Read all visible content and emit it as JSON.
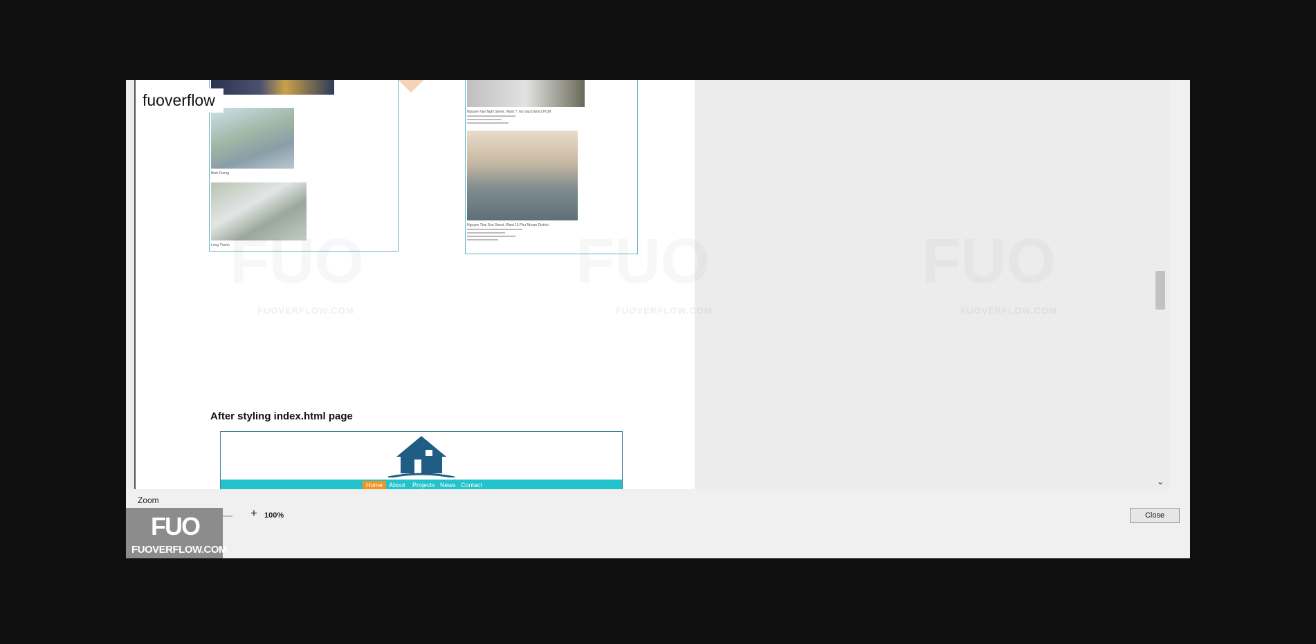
{
  "brand_label": "fuoverflow",
  "section_heading": "After styling index.html page",
  "nav_items": [
    "Home",
    "About",
    "Projects",
    "News",
    "Contact"
  ],
  "cards": {
    "left_captions": [
      "Binh Duong",
      "Long Thanh"
    ],
    "right_captions": [
      "Nguyen Van Nghi Street, Ward 7, Go Vap District HCM",
      "Nguyen Thai Son Street, Ward 15 Phu Nhuan District"
    ]
  },
  "watermark_text": "FUOVERFLOW.COM",
  "zoom": {
    "label": "Zoom",
    "minus": "-",
    "plus": "+",
    "value": "100%"
  },
  "close_label": "Close",
  "logo": {
    "big": "FUO",
    "small": "FUOVERFLOW.COM"
  },
  "icons": {
    "scroll_down": "chevron-down-icon"
  },
  "colors": {
    "navbar": "#22c3ca",
    "nav_active": "#f39324",
    "card_border": "#5fb3c6",
    "zoom_thumb": "#1e68c6"
  }
}
